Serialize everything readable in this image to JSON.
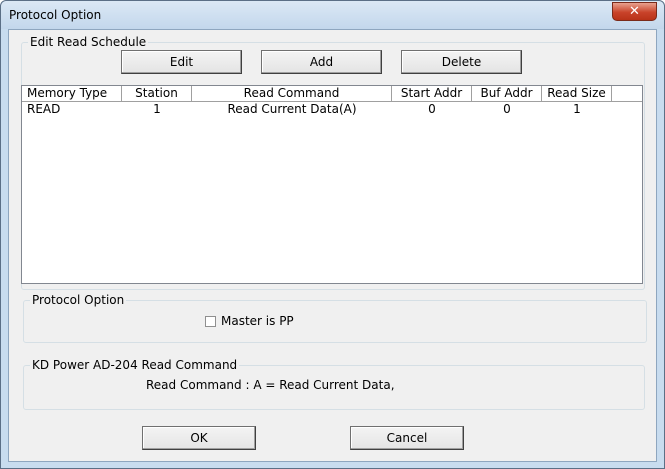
{
  "window": {
    "title": "Protocol Option",
    "close_symbol": "✕"
  },
  "schedule": {
    "group_label": "Edit Read Schedule",
    "buttons": {
      "edit": "Edit",
      "add": "Add",
      "delete": "Delete"
    },
    "columns": [
      "Memory Type",
      "Station",
      "Read Command",
      "Start Addr",
      "Buf Addr",
      "Read Size"
    ],
    "rows": [
      [
        "READ",
        "1",
        "Read Current Data(A)",
        "0",
        "0",
        "1"
      ]
    ]
  },
  "protocol": {
    "group_label": "Protocol Option",
    "checkbox_label": "Master is PP",
    "checked": false
  },
  "command_info": {
    "group_label": "KD Power AD-204 Read Command",
    "text": "Read Command : A = Read Current Data,"
  },
  "footer": {
    "ok": "OK",
    "cancel": "Cancel"
  },
  "icons": {
    "close": "close-icon"
  },
  "colors": {
    "close_button": "#c9432a",
    "title_bar": "#c8dcef"
  }
}
